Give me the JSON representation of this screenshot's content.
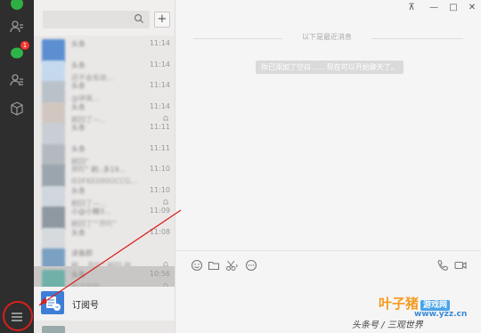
{
  "rail": {
    "chat_badge": "1",
    "icons": [
      "chat-icon",
      "contacts-icon",
      "favorites-icon",
      "files-icon",
      "menu-icon"
    ]
  },
  "search": {
    "placeholder": "",
    "add_label": "+"
  },
  "sessions": [
    {
      "name": "头条",
      "time": "11:14",
      "preview": "",
      "muted": false
    },
    {
      "name": "头条",
      "time": "11:14",
      "preview": "还不会有收...",
      "muted": false
    },
    {
      "name": "头条",
      "time": "11:14",
      "preview": "@钟美...",
      "muted": false
    },
    {
      "name": "头条",
      "time": "11:14",
      "preview": "刷回了—...",
      "muted": true
    },
    {
      "name": "头条",
      "time": "11:11",
      "preview": "",
      "muted": false
    },
    {
      "name": "头条",
      "time": "11:11",
      "preview": "刷回\"",
      "muted": false
    },
    {
      "name": "开吖\" 刷:.多19...",
      "time": "11:10",
      "preview": "IE0FKE090OCCG...",
      "muted": false
    },
    {
      "name": "头条",
      "time": "11:10",
      "preview": "刷回了—...",
      "muted": true
    },
    {
      "name": "小@小糖3...",
      "time": "11:09",
      "preview": "刷回了\"\"开吖\"",
      "muted": false
    },
    {
      "name": "头条",
      "time": "11:08",
      "preview": "",
      "muted": false
    },
    {
      "name": "读备群",
      "time": "",
      "preview": "刷... 开吖\" 刷回:南...",
      "muted": true
    },
    {
      "name": "头条",
      "time": "10:56",
      "preview": "加了空白......",
      "muted": true
    }
  ],
  "subscription": {
    "label": "订阅号"
  },
  "window_controls": [
    "pin-icon",
    "minimize-icon",
    "maximize-icon",
    "close-icon"
  ],
  "window_glyphs": {
    "pin": "⊼",
    "min": "—",
    "max": "□",
    "close": "✕"
  },
  "chat": {
    "history_label": "以下是最近消息",
    "system_message": "你已添加了空白...... 现在可以开始聊天了。"
  },
  "toolbar": {
    "left": [
      "emoji-icon",
      "folder-icon",
      "scissors-icon",
      "chat-history-icon"
    ],
    "right": [
      "phone-icon",
      "video-icon"
    ]
  },
  "watermark": {
    "brand": "叶子猪",
    "tag": "游戏网",
    "url": "www.yzz.cn",
    "caption": "头条号 / 三观世界"
  },
  "colors": {
    "accent_red": "#d8201c",
    "badge": "#f43530",
    "rail": "#2e2e2e"
  }
}
